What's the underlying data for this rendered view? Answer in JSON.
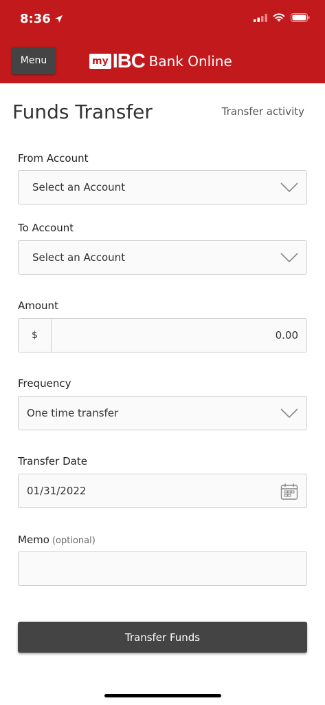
{
  "status_bar": {
    "time": "8:36",
    "icons": [
      "location-arrow-icon",
      "cellular-signal-icon",
      "wifi-icon",
      "battery-icon"
    ]
  },
  "header": {
    "menu_label": "Menu",
    "logo_my": "my",
    "logo_ibc": "IBC",
    "logo_rest": "Bank Online",
    "brand_color": "#c2191c"
  },
  "page": {
    "title": "Funds Transfer",
    "activity_link": "Transfer activity"
  },
  "form": {
    "from_account": {
      "label": "From Account",
      "value": "Select an Account"
    },
    "to_account": {
      "label": "To Account",
      "value": "Select an Account"
    },
    "amount": {
      "label": "Amount",
      "currency": "$",
      "value": "0.00"
    },
    "frequency": {
      "label": "Frequency",
      "value": "One time transfer"
    },
    "transfer_date": {
      "label": "Transfer Date",
      "value": "01/31/2022"
    },
    "memo": {
      "label": "Memo",
      "optional": "(optional)",
      "value": ""
    },
    "submit_label": "Transfer Funds"
  },
  "colors": {
    "button": "#444444",
    "field_border": "#cfcfcf"
  }
}
